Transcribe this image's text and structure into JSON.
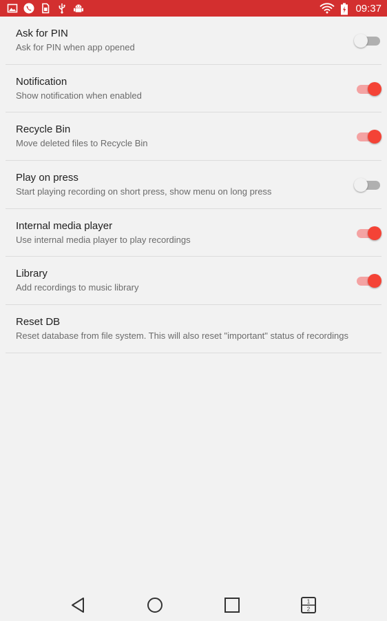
{
  "status_bar": {
    "time": "09:37",
    "left_icons": [
      "image-icon",
      "phone-icon",
      "sim-icon",
      "usb-icon",
      "android-icon"
    ],
    "right_icons": [
      "wifi-icon",
      "battery-icon"
    ],
    "background": "#d32f2f"
  },
  "settings": [
    {
      "title": "Ask for PIN",
      "summary": "Ask for PIN when app opened",
      "has_switch": true,
      "enabled": false
    },
    {
      "title": "Notification",
      "summary": "Show notification when enabled",
      "has_switch": true,
      "enabled": true
    },
    {
      "title": "Recycle Bin",
      "summary": "Move deleted files to Recycle Bin",
      "has_switch": true,
      "enabled": true
    },
    {
      "title": "Play on press",
      "summary": "Start playing recording on short press, show menu on long press",
      "has_switch": true,
      "enabled": false
    },
    {
      "title": "Internal media player",
      "summary": "Use internal media player to play recordings",
      "has_switch": true,
      "enabled": true
    },
    {
      "title": "Library",
      "summary": "Add recordings to music library",
      "has_switch": true,
      "enabled": true
    },
    {
      "title": "Reset DB",
      "summary": "Reset database from file system. This will also reset \"important\" status of recordings",
      "has_switch": false
    }
  ],
  "nav_bar": {
    "buttons": [
      "back-icon",
      "home-icon",
      "recents-icon",
      "split-screen-icon"
    ],
    "split_numbers": [
      "1",
      "2"
    ]
  },
  "colors": {
    "accent": "#f44336",
    "accent_track": "#f4a3a3",
    "switch_off_track": "#b0b0b0",
    "switch_off_thumb": "#f1f1f1",
    "background": "#f2f2f2",
    "divider": "#dcdcdc"
  }
}
